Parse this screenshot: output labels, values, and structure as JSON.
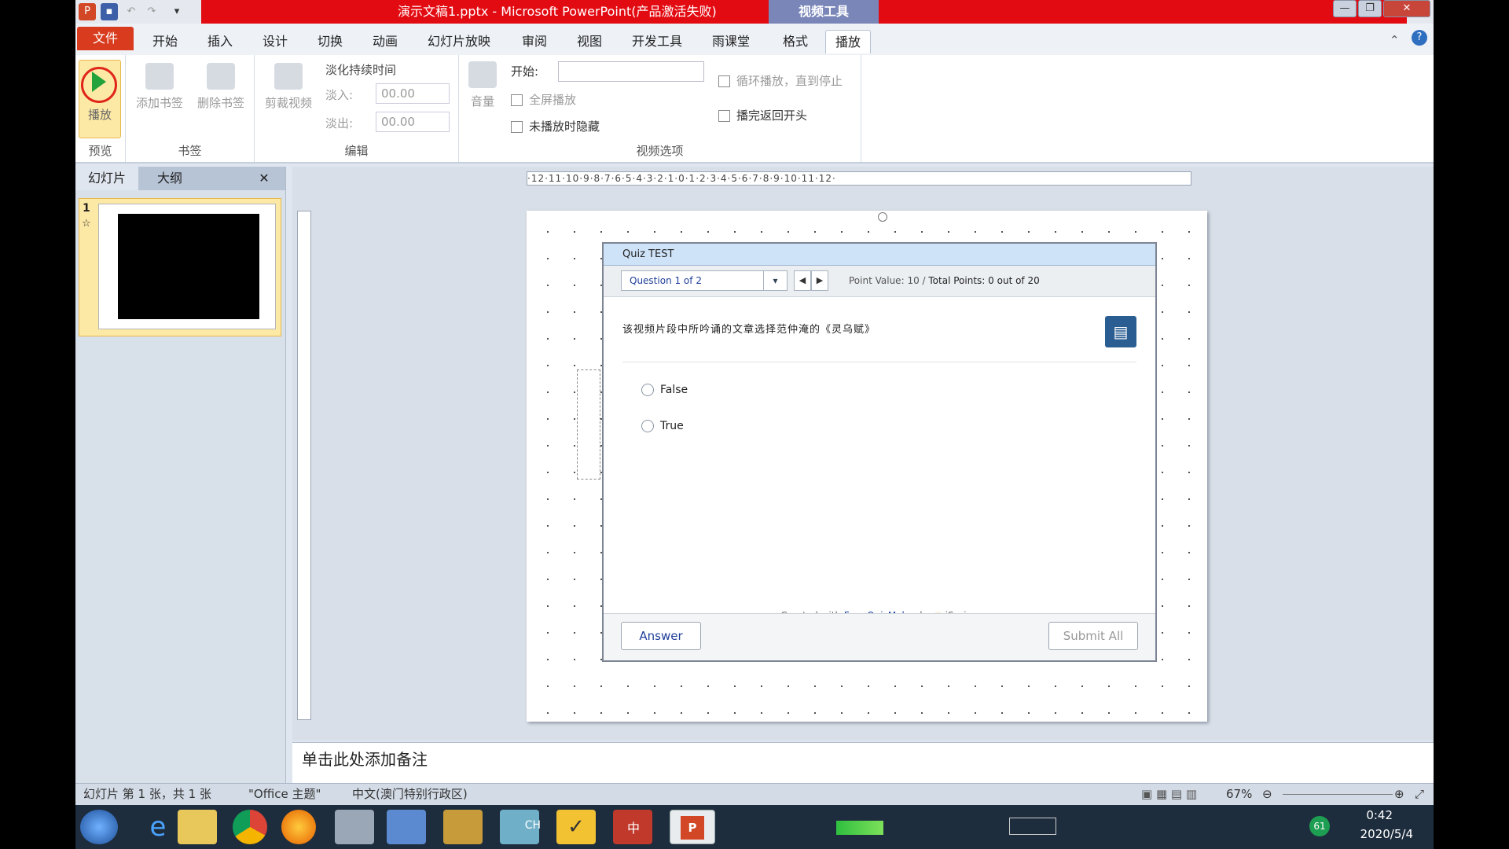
{
  "window": {
    "title": "演示文稿1.pptx - Microsoft PowerPoint(产品激活失败)",
    "context_tab_group": "视频工具",
    "ppt_logo": "P",
    "colors": {
      "titlebar": "#e30b12",
      "file_tab": "#d83b1d",
      "play_green": "#22a23a"
    }
  },
  "tabs": [
    "文件",
    "开始",
    "插入",
    "设计",
    "切换",
    "动画",
    "幻灯片放映",
    "审阅",
    "视图",
    "开发工具",
    "雨课堂",
    "格式",
    "播放"
  ],
  "ribbon": {
    "preview": {
      "play_label": "播放",
      "group": "预览"
    },
    "bookmarks": {
      "add": "添加书签",
      "remove": "删除书签",
      "group": "书签"
    },
    "editing": {
      "trim": "剪裁视频",
      "fade_title": "淡化持续时间",
      "fade_in_label": "淡入:",
      "fade_in_value": "00.00",
      "fade_out_label": "淡出:",
      "fade_out_value": "00.00",
      "group": "编辑"
    },
    "video_options": {
      "volume": "音量",
      "start_label": "开始:",
      "start_value": "",
      "fullscreen": "全屏播放",
      "hide_when_not_playing": "未播放时隐藏",
      "loop": "循环播放，直到停止",
      "rewind": "播完返回开头",
      "group": "视频选项"
    }
  },
  "left_pane": {
    "tab_slides": "幻灯片",
    "tab_outline": "大纲",
    "close": "✕",
    "slide_number": "1",
    "transition_marker": "☆"
  },
  "ruler_h": "·12·11·10·9·8·7·6·5·4·3·2·1·0·1·2·3·4·5·6·7·8·9·10·11·12·",
  "quiz": {
    "title": "Quiz TEST",
    "question_select": "Question 1 of 2",
    "point_value_label": "Point Value:",
    "point_value": "10",
    "total_points_label": "Total Points:",
    "total_points": "0",
    "out_of": "out of 20",
    "question": "该视频片段中所吟诵的文章选择范仲淹的《灵乌赋》",
    "options": [
      "False",
      "True"
    ],
    "credit_prefix": "Created with",
    "credit_link": "Free QuizMaker",
    "credit_by": "by",
    "credit_brand": "iSpring",
    "answer_button": "Answer",
    "submit_button": "Submit All"
  },
  "notes": {
    "placeholder": "单击此处添加备注"
  },
  "status": {
    "slide_info": "幻灯片 第 1 张，共 1 张",
    "theme": "\"Office 主题\"",
    "language": "中文(澳门特别行政区)",
    "zoom": "67%"
  },
  "taskbar": {
    "input_indicator": "CH",
    "ime": "中",
    "battery": "61",
    "time": "0:42",
    "date": "2020/5/4"
  }
}
